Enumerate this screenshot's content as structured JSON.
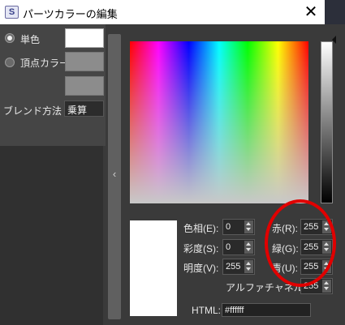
{
  "window": {
    "title": "パーツカラーの編集",
    "icon": "app-icon",
    "close_label": "✕"
  },
  "left_panel": {
    "single_color_label": "単色",
    "vertex_color_label": "頂点カラー",
    "single_color_checked": true,
    "vertex_color_checked": false,
    "blend_label": "ブレンド方法",
    "blend_value": "乗算"
  },
  "collapse": {
    "chevron": "‹"
  },
  "color_fields": {
    "hue": {
      "label": "色相(E):",
      "value": "0"
    },
    "saturation": {
      "label": "彩度(S):",
      "value": "0"
    },
    "brightness": {
      "label": "明度(V):",
      "value": "255"
    },
    "red": {
      "label": "赤(R):",
      "value": "255"
    },
    "green": {
      "label": "緑(G):",
      "value": "255"
    },
    "blue": {
      "label": "青(U):",
      "value": "255"
    },
    "alpha": {
      "label": "アルファチャネル(L):",
      "value": "255"
    },
    "html": {
      "label": "HTML:",
      "value": "#ffffff"
    }
  },
  "colors": {
    "current": "#ffffff",
    "annotation": "#e10000"
  }
}
